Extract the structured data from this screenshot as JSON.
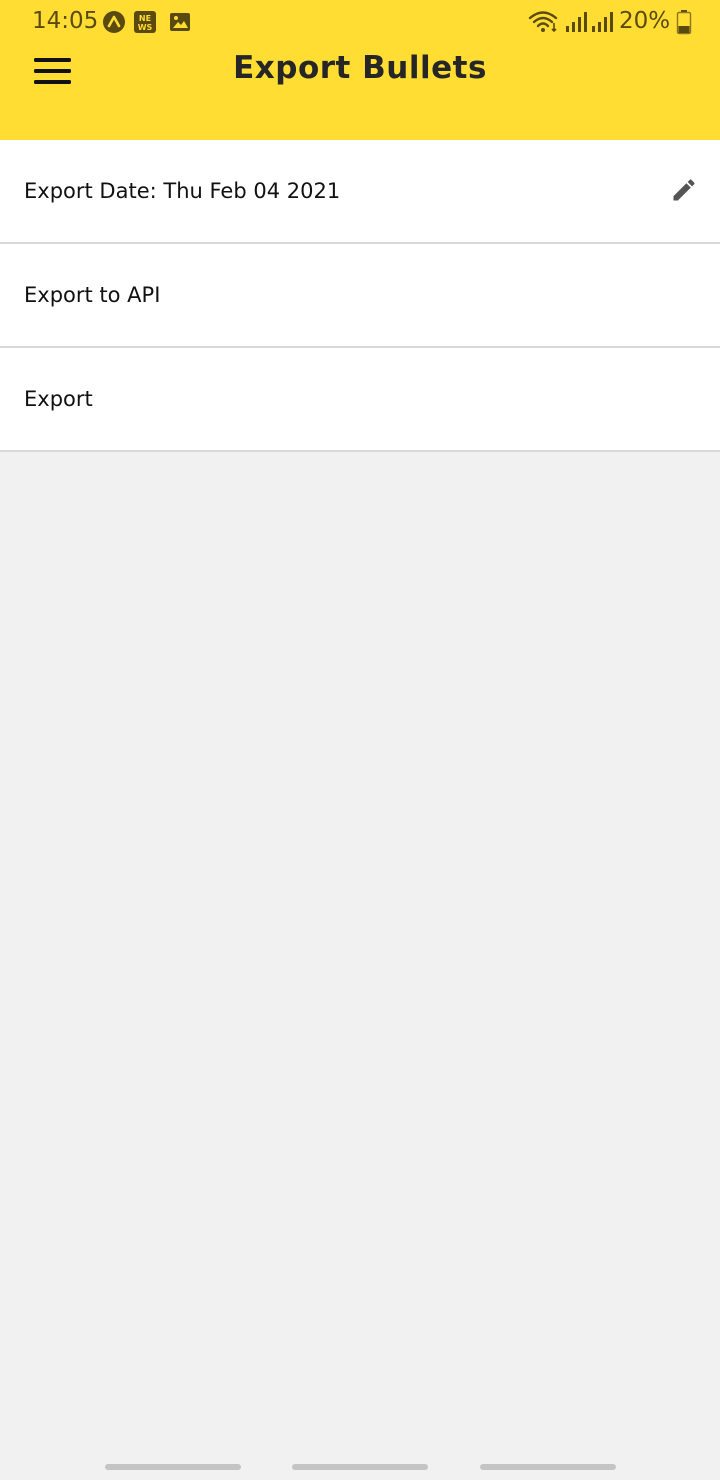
{
  "status_bar": {
    "time": "14:05",
    "battery": "20%",
    "icons": [
      "app-a-icon",
      "news-icon",
      "image-icon",
      "wifi-icon",
      "signal-icon",
      "signal-icon",
      "battery-icon"
    ]
  },
  "header": {
    "title": "Export Bullets",
    "menu_icon": "hamburger-menu-icon",
    "background_color": "#ffdd33"
  },
  "list": {
    "items": [
      {
        "label": "Export Date: Thu Feb 04 2021",
        "action_icon": "pencil-edit-icon"
      },
      {
        "label": "Export to API"
      },
      {
        "label": "Export"
      }
    ]
  },
  "navigation_bar": {
    "handles": 3
  }
}
